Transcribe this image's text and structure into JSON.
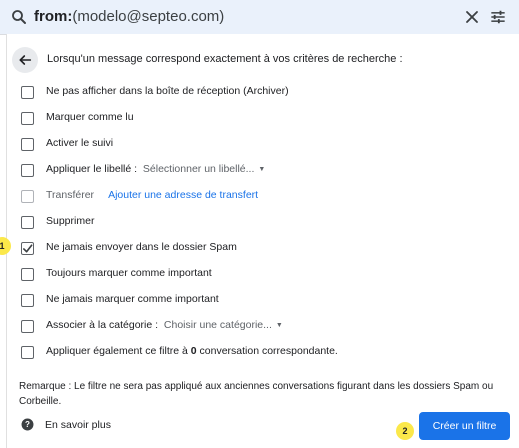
{
  "search": {
    "operator": "from:",
    "value": "(modelo@septeo.com)"
  },
  "filter": {
    "criteria_text": "Lorsqu'un message correspond exactement à vos critères de recherche :",
    "options": [
      {
        "label": "Ne pas afficher dans la boîte de réception (Archiver)",
        "checked": false
      },
      {
        "label": "Marquer comme lu",
        "checked": false
      },
      {
        "label": "Activer le suivi",
        "checked": false
      },
      {
        "label": "Appliquer le libellé :",
        "select": "Sélectionner un libellé...",
        "checked": false
      },
      {
        "label": "Transférer",
        "link": "Ajouter une adresse de transfert",
        "checked": false,
        "disabled": true
      },
      {
        "label": "Supprimer",
        "checked": false
      },
      {
        "label": "Ne jamais envoyer dans le dossier Spam",
        "checked": true
      },
      {
        "label": "Toujours marquer comme important",
        "checked": false
      },
      {
        "label": "Ne jamais marquer comme important",
        "checked": false
      },
      {
        "label": "Associer à la catégorie :",
        "select": "Choisir une catégorie...",
        "checked": false
      },
      {
        "label_pre": "Appliquer également ce filtre à ",
        "label_count": "0",
        "label_post": " conversation correspondante.",
        "checked": false
      }
    ],
    "remark": "Remarque : Le filtre ne sera pas appliqué aux anciennes conversations figurant dans les dossiers Spam ou Corbeille.",
    "learn_more": "En savoir plus",
    "create_button": "Créer un filtre"
  },
  "markers": {
    "one": "1",
    "two": "2"
  },
  "colors": {
    "accent": "#1a73e8",
    "marker": "#fbe84a"
  },
  "icons": [
    "search-icon",
    "close-icon",
    "tune-icon",
    "arrow-back-icon",
    "help-icon",
    "checkmark-icon",
    "caret-down-icon"
  ]
}
